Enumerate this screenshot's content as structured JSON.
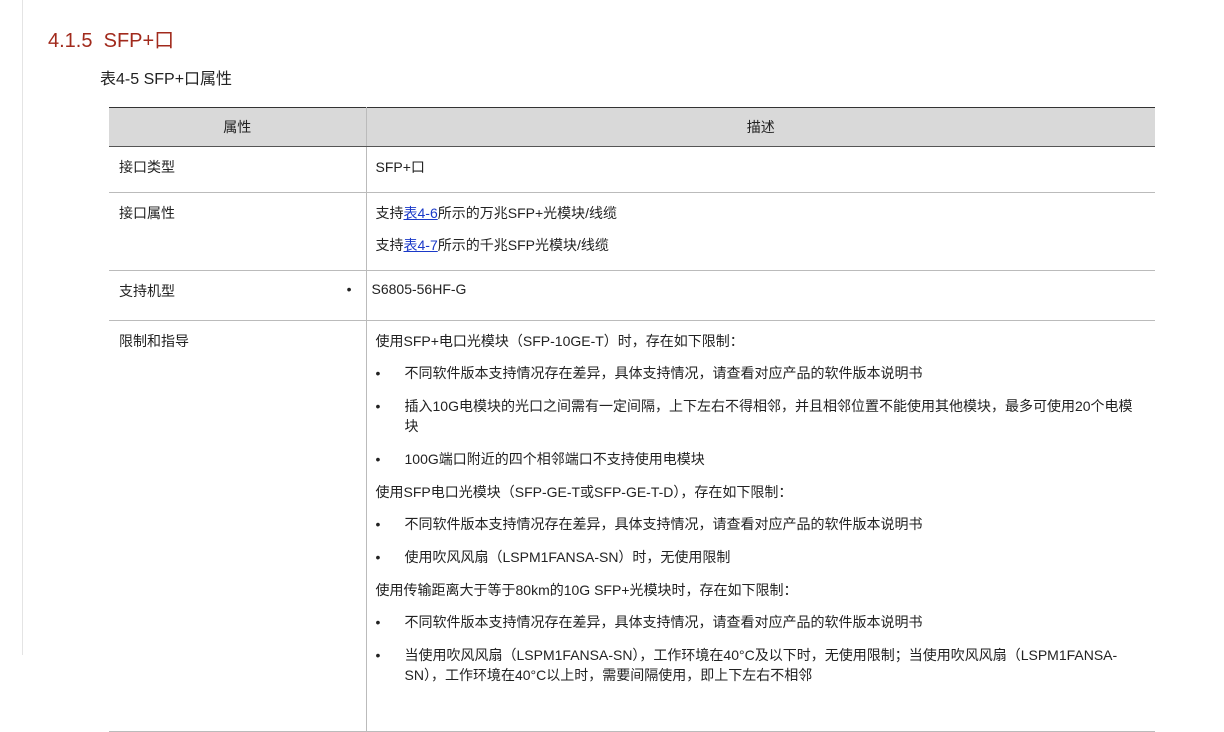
{
  "section": {
    "number": "4.1.5",
    "title": "SFP+口"
  },
  "table_caption": "表4-5 SFP+口属性",
  "table": {
    "headers": [
      "属性",
      "描述"
    ],
    "rows": {
      "type": {
        "key": "接口类型",
        "value": "SFP+口"
      },
      "attr": {
        "key": "接口属性",
        "lines": [
          {
            "pre": "支持",
            "link": "表4-6",
            "post": "所示的万兆SFP+光模块/线缆"
          },
          {
            "pre": "支持",
            "link": "表4-7",
            "post": "所示的千兆SFP光模块/线缆"
          }
        ]
      },
      "model": {
        "key": "支持机型",
        "bullet": "•",
        "value": "S6805-56HF-G"
      },
      "limit": {
        "key": "限制和指导",
        "intro1": "使用SFP+电口光模块（SFP-10GE-T）时，存在如下限制：",
        "bullets1": [
          "不同软件版本支持情况存在差异，具体支持情况，请查看对应产品的软件版本说明书",
          "插入10G电模块的光口之间需有一定间隔，上下左右不得相邻，并且相邻位置不能使用其他模块，最多可使用20个电模块",
          "100G端口附近的四个相邻端口不支持使用电模块"
        ],
        "intro2": "使用SFP电口光模块（SFP-GE-T或SFP-GE-T-D），存在如下限制：",
        "bullets2": [
          "不同软件版本支持情况存在差异，具体支持情况，请查看对应产品的软件版本说明书",
          "使用吹风风扇（LSPM1FANSA-SN）时，无使用限制"
        ],
        "intro3": "使用传输距离大于等于80km的10G SFP+光模块时，存在如下限制：",
        "bullets3": [
          "不同软件版本支持情况存在差异，具体支持情况，请查看对应产品的软件版本说明书",
          "当使用吹风风扇（LSPM1FANSA-SN），工作环境在40°C及以下时，无使用限制；当使用吹风风扇（LSPM1FANSA-SN），工作环境在40°C以上时，需要间隔使用，即上下左右不相邻"
        ],
        "bullet_char": "•"
      }
    }
  }
}
